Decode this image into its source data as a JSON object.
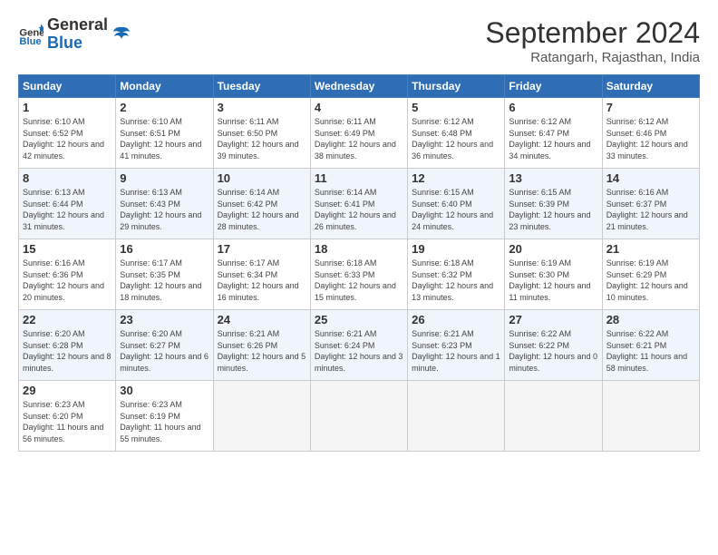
{
  "header": {
    "logo_text_general": "General",
    "logo_text_blue": "Blue",
    "month_title": "September 2024",
    "subtitle": "Ratangarh, Rajasthan, India"
  },
  "days_of_week": [
    "Sunday",
    "Monday",
    "Tuesday",
    "Wednesday",
    "Thursday",
    "Friday",
    "Saturday"
  ],
  "weeks": [
    [
      {
        "day": "1",
        "sunrise": "6:10 AM",
        "sunset": "6:52 PM",
        "daylight": "12 hours and 42 minutes."
      },
      {
        "day": "2",
        "sunrise": "6:10 AM",
        "sunset": "6:51 PM",
        "daylight": "12 hours and 41 minutes."
      },
      {
        "day": "3",
        "sunrise": "6:11 AM",
        "sunset": "6:50 PM",
        "daylight": "12 hours and 39 minutes."
      },
      {
        "day": "4",
        "sunrise": "6:11 AM",
        "sunset": "6:49 PM",
        "daylight": "12 hours and 38 minutes."
      },
      {
        "day": "5",
        "sunrise": "6:12 AM",
        "sunset": "6:48 PM",
        "daylight": "12 hours and 36 minutes."
      },
      {
        "day": "6",
        "sunrise": "6:12 AM",
        "sunset": "6:47 PM",
        "daylight": "12 hours and 34 minutes."
      },
      {
        "day": "7",
        "sunrise": "6:12 AM",
        "sunset": "6:46 PM",
        "daylight": "12 hours and 33 minutes."
      }
    ],
    [
      {
        "day": "8",
        "sunrise": "6:13 AM",
        "sunset": "6:44 PM",
        "daylight": "12 hours and 31 minutes."
      },
      {
        "day": "9",
        "sunrise": "6:13 AM",
        "sunset": "6:43 PM",
        "daylight": "12 hours and 29 minutes."
      },
      {
        "day": "10",
        "sunrise": "6:14 AM",
        "sunset": "6:42 PM",
        "daylight": "12 hours and 28 minutes."
      },
      {
        "day": "11",
        "sunrise": "6:14 AM",
        "sunset": "6:41 PM",
        "daylight": "12 hours and 26 minutes."
      },
      {
        "day": "12",
        "sunrise": "6:15 AM",
        "sunset": "6:40 PM",
        "daylight": "12 hours and 24 minutes."
      },
      {
        "day": "13",
        "sunrise": "6:15 AM",
        "sunset": "6:39 PM",
        "daylight": "12 hours and 23 minutes."
      },
      {
        "day": "14",
        "sunrise": "6:16 AM",
        "sunset": "6:37 PM",
        "daylight": "12 hours and 21 minutes."
      }
    ],
    [
      {
        "day": "15",
        "sunrise": "6:16 AM",
        "sunset": "6:36 PM",
        "daylight": "12 hours and 20 minutes."
      },
      {
        "day": "16",
        "sunrise": "6:17 AM",
        "sunset": "6:35 PM",
        "daylight": "12 hours and 18 minutes."
      },
      {
        "day": "17",
        "sunrise": "6:17 AM",
        "sunset": "6:34 PM",
        "daylight": "12 hours and 16 minutes."
      },
      {
        "day": "18",
        "sunrise": "6:18 AM",
        "sunset": "6:33 PM",
        "daylight": "12 hours and 15 minutes."
      },
      {
        "day": "19",
        "sunrise": "6:18 AM",
        "sunset": "6:32 PM",
        "daylight": "12 hours and 13 minutes."
      },
      {
        "day": "20",
        "sunrise": "6:19 AM",
        "sunset": "6:30 PM",
        "daylight": "12 hours and 11 minutes."
      },
      {
        "day": "21",
        "sunrise": "6:19 AM",
        "sunset": "6:29 PM",
        "daylight": "12 hours and 10 minutes."
      }
    ],
    [
      {
        "day": "22",
        "sunrise": "6:20 AM",
        "sunset": "6:28 PM",
        "daylight": "12 hours and 8 minutes."
      },
      {
        "day": "23",
        "sunrise": "6:20 AM",
        "sunset": "6:27 PM",
        "daylight": "12 hours and 6 minutes."
      },
      {
        "day": "24",
        "sunrise": "6:21 AM",
        "sunset": "6:26 PM",
        "daylight": "12 hours and 5 minutes."
      },
      {
        "day": "25",
        "sunrise": "6:21 AM",
        "sunset": "6:24 PM",
        "daylight": "12 hours and 3 minutes."
      },
      {
        "day": "26",
        "sunrise": "6:21 AM",
        "sunset": "6:23 PM",
        "daylight": "12 hours and 1 minute."
      },
      {
        "day": "27",
        "sunrise": "6:22 AM",
        "sunset": "6:22 PM",
        "daylight": "12 hours and 0 minutes."
      },
      {
        "day": "28",
        "sunrise": "6:22 AM",
        "sunset": "6:21 PM",
        "daylight": "11 hours and 58 minutes."
      }
    ],
    [
      {
        "day": "29",
        "sunrise": "6:23 AM",
        "sunset": "6:20 PM",
        "daylight": "11 hours and 56 minutes."
      },
      {
        "day": "30",
        "sunrise": "6:23 AM",
        "sunset": "6:19 PM",
        "daylight": "11 hours and 55 minutes."
      },
      null,
      null,
      null,
      null,
      null
    ]
  ],
  "labels": {
    "sunrise": "Sunrise:",
    "sunset": "Sunset:",
    "daylight": "Daylight:"
  }
}
